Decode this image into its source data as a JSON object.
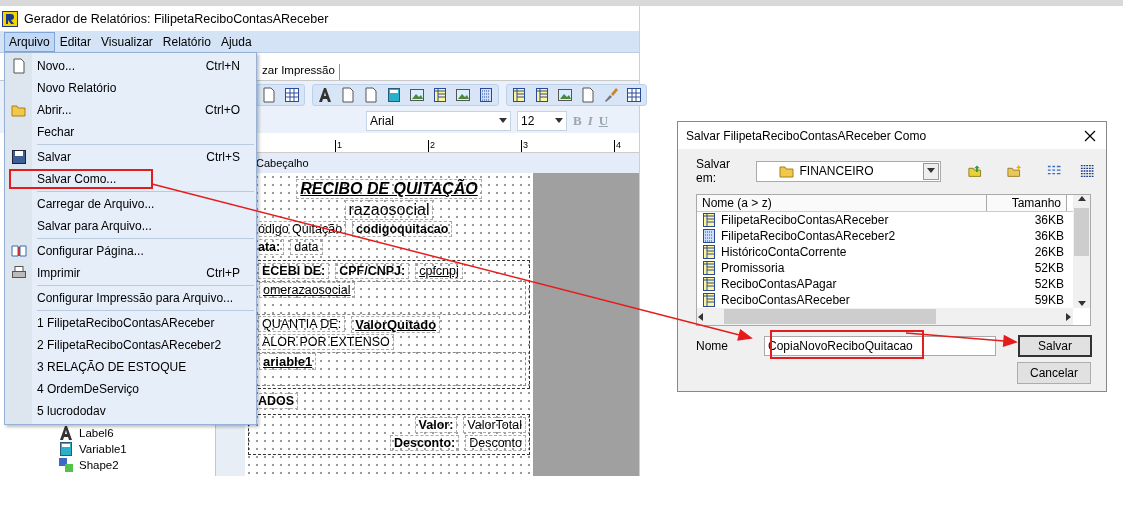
{
  "window": {
    "title": "Gerador de Relatórios: FilipetaReciboContasAReceber"
  },
  "menubar": [
    {
      "label": "Arquivo",
      "selected": true
    },
    {
      "label": "Editar",
      "selected": false
    },
    {
      "label": "Visualizar",
      "selected": false
    },
    {
      "label": "Relatório",
      "selected": false
    },
    {
      "label": "Ajuda",
      "selected": false
    }
  ],
  "tab_label": "zar Impressão",
  "font_toolbar": {
    "font": "Arial",
    "size": "12",
    "bold": "B",
    "italic": "I",
    "underline": "U"
  },
  "ruler": [
    "1",
    "2",
    "3",
    "4"
  ],
  "tree": [
    {
      "label": "Label6"
    },
    {
      "label": "Variable1"
    },
    {
      "label": "Shape2"
    }
  ],
  "report": {
    "band": "Cabeçalho",
    "sections": [
      {
        "kind": "plain",
        "rows": [
          {
            "kind": "centered",
            "fields": [
              {
                "kind": "title",
                "text": "RECIBO DE QUITAÇÃO"
              }
            ]
          },
          {
            "kind": "centered",
            "fields": [
              {
                "kind": "subtitle",
                "text": "razaosocial"
              }
            ]
          },
          {
            "kind": "line",
            "fields": [
              {
                "kind": "label",
                "text": "ódigo Quitação"
              },
              {
                "kind": "strong",
                "text": "codigoquitacao"
              }
            ]
          },
          {
            "kind": "line",
            "fields": [
              {
                "kind": "strong",
                "text": "ata:"
              },
              {
                "kind": "label",
                "text": "data"
              }
            ]
          }
        ]
      },
      {
        "kind": "boxed",
        "rows": [
          {
            "kind": "line",
            "fields": [
              {
                "kind": "strong",
                "text": "ECEBI DE:"
              },
              {
                "kind": "strong",
                "text": "CPF/CNPJ:"
              },
              {
                "kind": "link",
                "text": "cpfcnpj"
              }
            ]
          },
          {
            "kind": "tall",
            "fields": [
              {
                "kind": "link",
                "text": "omerazaosocial"
              }
            ]
          },
          {
            "kind": "line",
            "fields": [
              {
                "kind": "label",
                "text": "QUANTIA DE:"
              },
              {
                "kind": "strong-link",
                "text": "ValorQuitado"
              }
            ]
          },
          {
            "kind": "line",
            "fields": [
              {
                "kind": "label",
                "text": "ALOR POR EXTENSO"
              }
            ]
          },
          {
            "kind": "tall",
            "fields": [
              {
                "kind": "strong-link",
                "text": "ariable1"
              }
            ]
          }
        ]
      },
      {
        "kind": "plain",
        "rows": [
          {
            "kind": "line",
            "fields": [
              {
                "kind": "strong",
                "text": "ADOS"
              }
            ]
          }
        ]
      },
      {
        "kind": "boxed",
        "rows": [
          {
            "kind": "totals",
            "fields": [
              {
                "kind": "strong",
                "text": "Valor:"
              },
              {
                "kind": "label",
                "text": "ValorTotal"
              }
            ]
          },
          {
            "kind": "totals",
            "fields": [
              {
                "kind": "strong",
                "text": "Desconto:"
              },
              {
                "kind": "label",
                "text": "Desconto"
              }
            ]
          }
        ]
      }
    ]
  },
  "menu": {
    "groups": [
      [
        {
          "label": "Novo...",
          "shortcut": "Ctrl+N",
          "highlighted": false
        },
        {
          "label": "Novo Relatório",
          "highlighted": false
        },
        {
          "label": "Abrir...",
          "shortcut": "Ctrl+O",
          "highlighted": false
        },
        {
          "label": "Fechar",
          "highlighted": false
        }
      ],
      [
        {
          "label": "Salvar",
          "shortcut": "Ctrl+S",
          "highlighted": false
        },
        {
          "label": "Salvar Como...",
          "highlighted": true
        }
      ],
      [
        {
          "label": "Carregar de Arquivo...",
          "highlighted": false
        },
        {
          "label": "Salvar para Arquivo...",
          "highlighted": false
        }
      ],
      [
        {
          "label": "Configurar Página...",
          "highlighted": false
        },
        {
          "label": "Imprimir",
          "shortcut": "Ctrl+P",
          "highlighted": false
        }
      ],
      [
        {
          "label": "Configurar Impressão para Arquivo...",
          "highlighted": false
        }
      ],
      [
        {
          "label": "1 FilipetaReciboContasAReceber",
          "highlighted": false
        },
        {
          "label": "2 FilipetaReciboContasAReceber2",
          "highlighted": false
        },
        {
          "label": "3 RELAÇÃO DE ESTOQUE",
          "highlighted": false
        },
        {
          "label": "4 OrdemDeServiço",
          "highlighted": false
        },
        {
          "label": "5 lucrododav",
          "highlighted": false
        }
      ]
    ]
  },
  "dialog": {
    "title": "Salvar FilipetaReciboContasAReceber Como",
    "save_in_label": "Salvar em:",
    "folder": "FINANCEIRO",
    "columns": [
      "Nome (a > z)",
      "Tamanho"
    ],
    "files": [
      {
        "name": "FilipetaReciboContasAReceber",
        "size": "36KB",
        "kind": "report"
      },
      {
        "name": "FilipetaReciboContasAReceber2",
        "size": "36KB",
        "kind": "grid"
      },
      {
        "name": "HistóricoContaCorrente",
        "size": "26KB",
        "kind": "report"
      },
      {
        "name": "Promissoria",
        "size": "52KB",
        "kind": "report"
      },
      {
        "name": "ReciboContasAPagar",
        "size": "52KB",
        "kind": "report"
      },
      {
        "name": "ReciboContasAReceber",
        "size": "59KB",
        "kind": "report"
      }
    ],
    "name_label": "Nome",
    "name_value": "CopiaNovoReciboQuitacao",
    "highlighted": true,
    "buttons": [
      {
        "label": "Salvar",
        "default": true
      },
      {
        "label": "Cancelar",
        "default": false
      }
    ]
  }
}
